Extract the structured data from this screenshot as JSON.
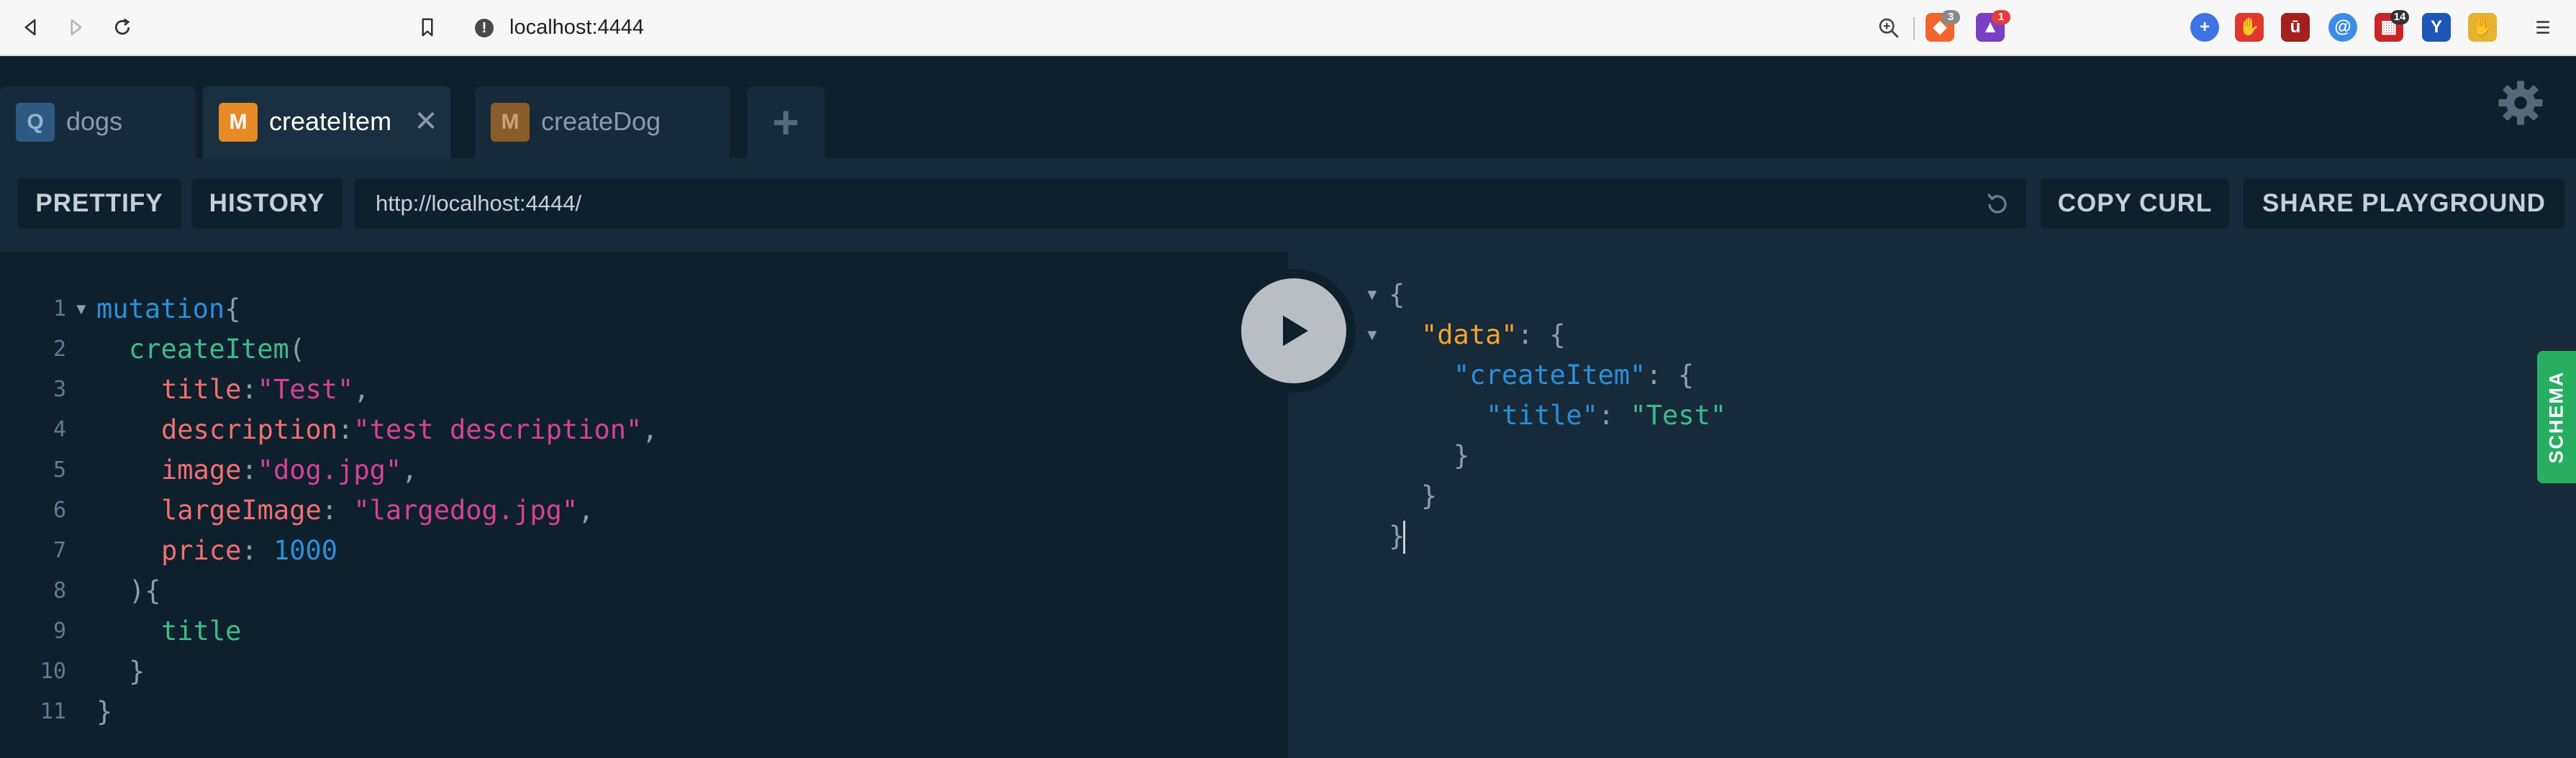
{
  "browser": {
    "url": "localhost:4444",
    "extensions": [
      {
        "icon": "brave-lion-icon",
        "badge": "3"
      },
      {
        "icon": "brave-rewards-icon",
        "badge": "1"
      },
      {
        "icon": "plus-circle-icon",
        "badge": ""
      },
      {
        "icon": "stop-hand-icon",
        "badge": ""
      },
      {
        "icon": "ublock-icon",
        "badge": ""
      },
      {
        "icon": "at-sign-icon",
        "badge": ""
      },
      {
        "icon": "calendar-icon",
        "badge": "14"
      },
      {
        "icon": "y-shield-icon",
        "badge": ""
      },
      {
        "icon": "hand-emoji-icon",
        "badge": ""
      }
    ]
  },
  "tabs": [
    {
      "badge": "Q",
      "label": "dogs",
      "badge_color": "#2d5a83",
      "active": false
    },
    {
      "badge": "M",
      "label": "createItem",
      "badge_color": "#e88a26",
      "active": true
    },
    {
      "badge": "M",
      "label": "createDog",
      "badge_color": "#8a5c2a",
      "active": false
    }
  ],
  "tab_close": "✕",
  "tab_add": "+",
  "toolbar": {
    "prettify": "PRETTIFY",
    "history": "HISTORY",
    "endpoint": "http://localhost:4444/",
    "copy_curl": "COPY CURL",
    "share": "SHARE PLAYGROUND"
  },
  "query_lines": [
    {
      "n": "1",
      "fold": true,
      "indent": 0,
      "tokens": [
        [
          "kw",
          "mutation"
        ],
        [
          "punc",
          "{"
        ]
      ]
    },
    {
      "n": "2",
      "fold": false,
      "indent": 1,
      "tokens": [
        [
          "fn",
          "createItem"
        ],
        [
          "punc",
          "("
        ]
      ]
    },
    {
      "n": "3",
      "fold": false,
      "indent": 2,
      "tokens": [
        [
          "arg",
          "title"
        ],
        [
          "punc",
          ":"
        ],
        [
          "str",
          "\"Test\""
        ],
        [
          "punc",
          ","
        ]
      ]
    },
    {
      "n": "4",
      "fold": false,
      "indent": 2,
      "tokens": [
        [
          "arg",
          "description"
        ],
        [
          "punc",
          ":"
        ],
        [
          "str",
          "\"test description\""
        ],
        [
          "punc",
          ","
        ]
      ]
    },
    {
      "n": "5",
      "fold": false,
      "indent": 2,
      "tokens": [
        [
          "arg",
          "image"
        ],
        [
          "punc",
          ":"
        ],
        [
          "str",
          "\"dog.jpg\""
        ],
        [
          "punc",
          ","
        ]
      ]
    },
    {
      "n": "6",
      "fold": false,
      "indent": 2,
      "tokens": [
        [
          "arg",
          "largeImage"
        ],
        [
          "punc",
          ": "
        ],
        [
          "str",
          "\"largedog.jpg\""
        ],
        [
          "punc",
          ","
        ]
      ]
    },
    {
      "n": "7",
      "fold": false,
      "indent": 2,
      "tokens": [
        [
          "arg",
          "price"
        ],
        [
          "punc",
          ": "
        ],
        [
          "num",
          "1000"
        ]
      ]
    },
    {
      "n": "8",
      "fold": false,
      "indent": 1,
      "tokens": [
        [
          "punc",
          "){"
        ]
      ]
    },
    {
      "n": "9",
      "fold": false,
      "indent": 2,
      "tokens": [
        [
          "field",
          "title"
        ]
      ]
    },
    {
      "n": "10",
      "fold": false,
      "indent": 1,
      "tokens": [
        [
          "punc",
          "}"
        ]
      ]
    },
    {
      "n": "11",
      "fold": false,
      "indent": 0,
      "tokens": [
        [
          "punc",
          "}"
        ]
      ]
    }
  ],
  "result_lines": [
    {
      "fold": true,
      "indent": 0,
      "tokens": [
        [
          "punc",
          "{"
        ]
      ]
    },
    {
      "fold": true,
      "indent": 1,
      "tokens": [
        [
          "key1",
          "\"data\""
        ],
        [
          "punc",
          ": {"
        ]
      ]
    },
    {
      "fold": false,
      "indent": 2,
      "tokens": [
        [
          "key2",
          "\"createItem\""
        ],
        [
          "punc",
          ": {"
        ]
      ]
    },
    {
      "fold": false,
      "indent": 3,
      "tokens": [
        [
          "key2",
          "\"title\""
        ],
        [
          "punc",
          ": "
        ],
        [
          "str",
          "\"Test\""
        ]
      ]
    },
    {
      "fold": false,
      "indent": 2,
      "tokens": [
        [
          "punc",
          "}"
        ]
      ]
    },
    {
      "fold": false,
      "indent": 1,
      "tokens": [
        [
          "punc",
          "}"
        ]
      ]
    },
    {
      "fold": false,
      "indent": 0,
      "tokens": [
        [
          "punc",
          "}"
        ]
      ]
    }
  ],
  "schema_label": "SCHEMA"
}
